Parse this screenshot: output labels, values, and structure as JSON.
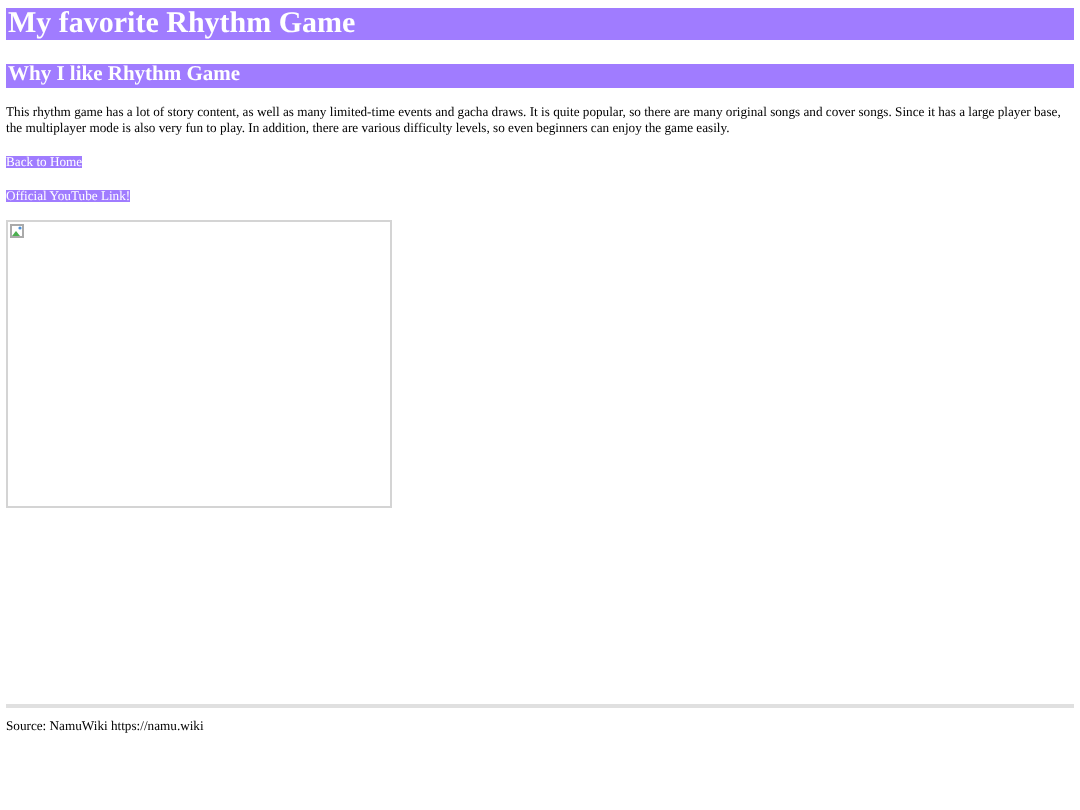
{
  "title": "My favorite Rhythm Game",
  "section": {
    "heading": "Why I like Rhythm Game",
    "body": "This rhythm game has a lot of story content, as well as many limited-time events and gacha draws. It is quite popular, so there are many original songs and cover songs. Since it has a large player base, the multiplayer mode is also very fun to play. In addition, there are various difficulty levels, so even beginners can enjoy the game easily."
  },
  "links": [
    "Back to Home",
    "Official YouTube Link!"
  ],
  "image": {
    "kind": "broken"
  },
  "footer": "Source: NamuWiki https://namu.wiki"
}
